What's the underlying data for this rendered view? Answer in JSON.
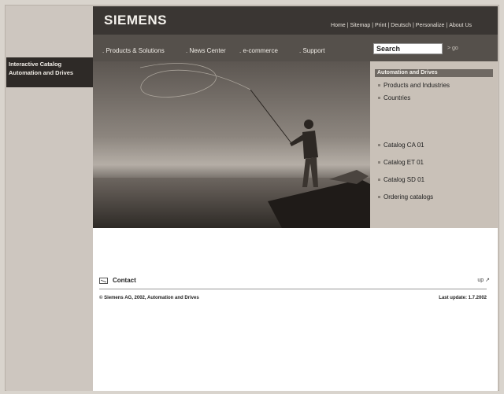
{
  "left": {
    "title_line1": "Interactive Catalog",
    "title_line2": "Automation and Drives"
  },
  "header": {
    "logo": "SIEMENS",
    "links": [
      "Home",
      "Sitemap",
      "Print",
      "Deutsch",
      "Personalize",
      "About Us"
    ],
    "link_separator": "|"
  },
  "nav": {
    "items": [
      ". Products & Solutions",
      ". News Center",
      ". e-commerce",
      ". Support"
    ],
    "search_placeholder": "Search",
    "go_label": "> go"
  },
  "panel": {
    "header": "Automation and Drives",
    "links_top": [
      "Products and Industries",
      "Countries"
    ],
    "links_bottom": [
      "Catalog CA 01",
      "Catalog ET 01",
      "Catalog SD 01",
      "Ordering catalogs"
    ]
  },
  "footer": {
    "contact_label": "Contact",
    "top_label": "up ↗",
    "copyright": "© Siemens AG, 2002, Automation and Drives",
    "last_update": "Last update: 1.7.2002"
  },
  "colors": {
    "topbar": "#3a3633",
    "navbar": "#55504b",
    "panel": "#c9c1b8",
    "sidebar": "#cdc6bf"
  }
}
